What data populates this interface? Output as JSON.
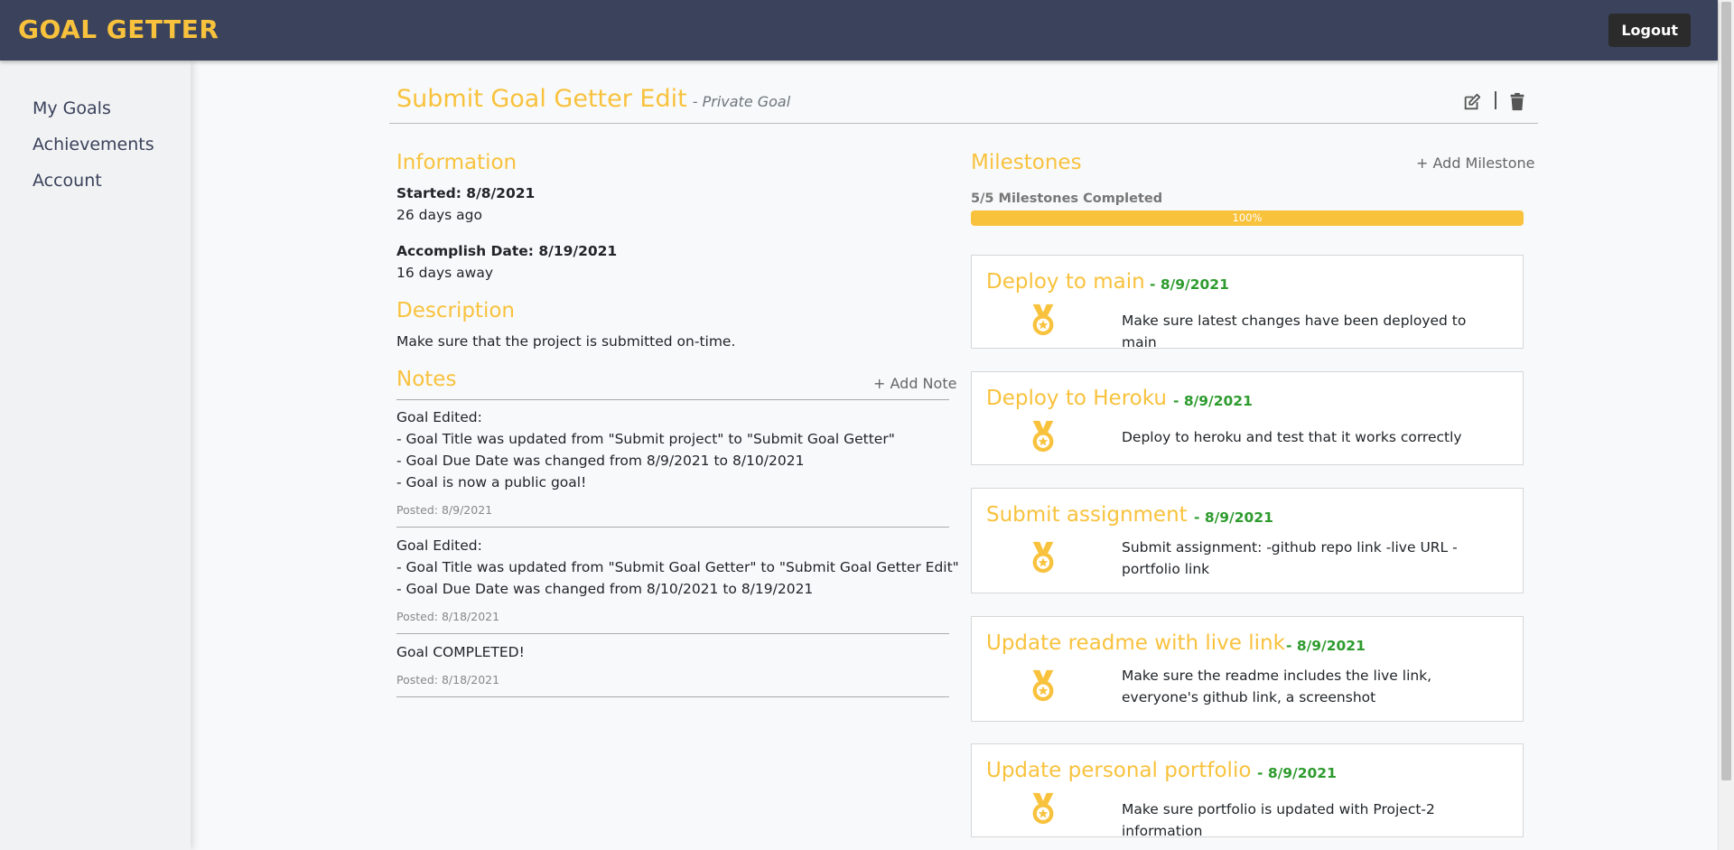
{
  "app": {
    "brand": "GOAL GETTER",
    "logout_label": "Logout"
  },
  "sidebar": {
    "items": [
      {
        "label": "My Goals"
      },
      {
        "label": "Achievements"
      },
      {
        "label": "Account"
      }
    ]
  },
  "goal": {
    "title": "Submit Goal Getter Edit",
    "privacy": "- Private Goal",
    "edit_icon": "edit-icon",
    "delete_icon": "trash-icon"
  },
  "information": {
    "heading": "Information",
    "started_label": "Started: 8/8/2021",
    "started_rel": "26 days ago",
    "accomplish_label": "Accomplish Date: 8/19/2021",
    "accomplish_rel": "16 days away"
  },
  "description": {
    "heading": "Description",
    "text": "Make sure that the project is submitted on-time."
  },
  "notes": {
    "heading": "Notes",
    "add_label": "+ Add Note",
    "items": [
      {
        "lines": [
          "Goal Edited:",
          "- Goal Title was updated from \"Submit project\" to \"Submit Goal Getter\"",
          "- Goal Due Date was changed from 8/9/2021 to 8/10/2021",
          "- Goal is now a public goal!"
        ],
        "posted": "Posted: 8/9/2021"
      },
      {
        "lines": [
          "Goal Edited:",
          "- Goal Title was updated from \"Submit Goal Getter\" to \"Submit Goal Getter Edit\"",
          "- Goal Due Date was changed from 8/10/2021 to 8/19/2021"
        ],
        "posted": "Posted: 8/18/2021"
      },
      {
        "lines": [
          "Goal COMPLETED!"
        ],
        "posted": "Posted: 8/18/2021"
      }
    ]
  },
  "milestones": {
    "heading": "Milestones",
    "add_label": "+ Add Milestone",
    "completed_text": "5/5 Milestones Completed",
    "progress_percent": 100,
    "progress_label": "100%",
    "accent_color": "#f8c23d",
    "date_color": "#2e9b2e",
    "items": [
      {
        "title": "Deploy to main",
        "date": "- 8/9/2021",
        "description": "Make sure latest changes have been deployed to main",
        "icon": "medal-icon"
      },
      {
        "title": "Deploy to Heroku",
        "date": "- 8/9/2021",
        "description": "Deploy to heroku and test that it works correctly",
        "icon": "medal-icon"
      },
      {
        "title": "Submit assignment",
        "date": "- 8/9/2021",
        "description": "Submit assignment: -github repo link -live URL -portfolio link",
        "icon": "medal-icon"
      },
      {
        "title": "Update readme with live link",
        "date": "- 8/9/2021",
        "description": "Make sure the readme includes the live link, everyone's github link, a screenshot",
        "icon": "medal-icon"
      },
      {
        "title": "Update personal portfolio",
        "date": "- 8/9/2021",
        "description": "Make sure portfolio is updated with Project-2 information",
        "icon": "medal-icon"
      }
    ]
  }
}
